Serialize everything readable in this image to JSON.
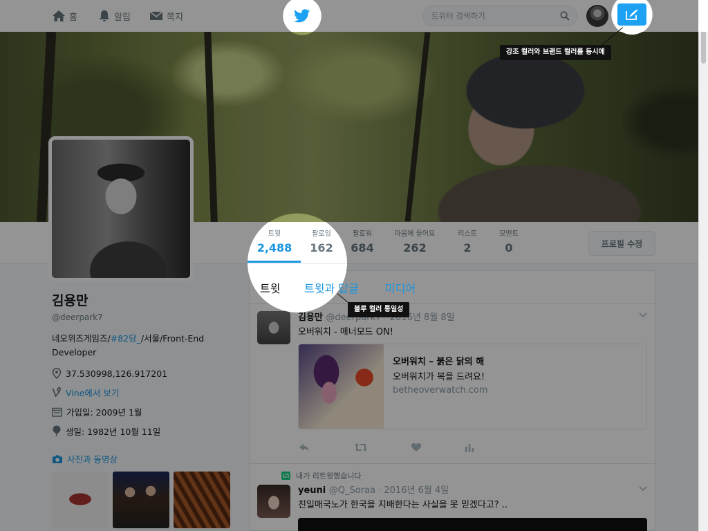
{
  "nav": {
    "home": "홈",
    "notifications": "알림",
    "messages": "쪽지",
    "search_placeholder": "트위터 검색하기"
  },
  "annotations": {
    "compose": "강조 컬러와 브랜드 컬러를 동시에",
    "tabs": "블루 컬러 통일성"
  },
  "stats": [
    {
      "label": "트윗",
      "value": "2,488"
    },
    {
      "label": "팔로잉",
      "value": "162"
    },
    {
      "label": "팔로워",
      "value": "684"
    },
    {
      "label": "마음에 들어요",
      "value": "262"
    },
    {
      "label": "리스트",
      "value": "2"
    },
    {
      "label": "모멘트",
      "value": "0"
    }
  ],
  "edit_profile": "프로필 수정",
  "profile": {
    "name": "김용만",
    "handle": "@deerpark7",
    "bio_prefix": "네오위즈게임즈/",
    "bio_link": "#82당_",
    "bio_suffix": "/서울/Front-End Developer",
    "location": "37.530998,126.917201",
    "vine": "Vine에서 보기",
    "joined": "가입일: 2009년 1월",
    "birthday": "생일: 1982년 10월 11일",
    "photos_videos": "사진과 동영상"
  },
  "tabs": [
    "트윗",
    "트윗과 답글",
    "미디어"
  ],
  "tweets": [
    {
      "author": "김용만",
      "handle": "@deerpark7 · 2016년 8월 8일",
      "text": "오버워치 - 매너모드 ON!",
      "card_title": "오버워치 – 붉은 닭의 해",
      "card_desc": "오버워치가 복을 드려요!",
      "card_url": "betheoverwatch.com"
    },
    {
      "retweet_label": "내가 리트윗했습니다",
      "author": "yeuni",
      "handle": "@Q_Soraa · 2016년 6월 4일",
      "text": "친일매국노가 한국을 지배한다는 사실을 못 믿겠다고? .."
    }
  ],
  "colors": {
    "brand": "#1da1f2",
    "link": "#1b95e0"
  }
}
